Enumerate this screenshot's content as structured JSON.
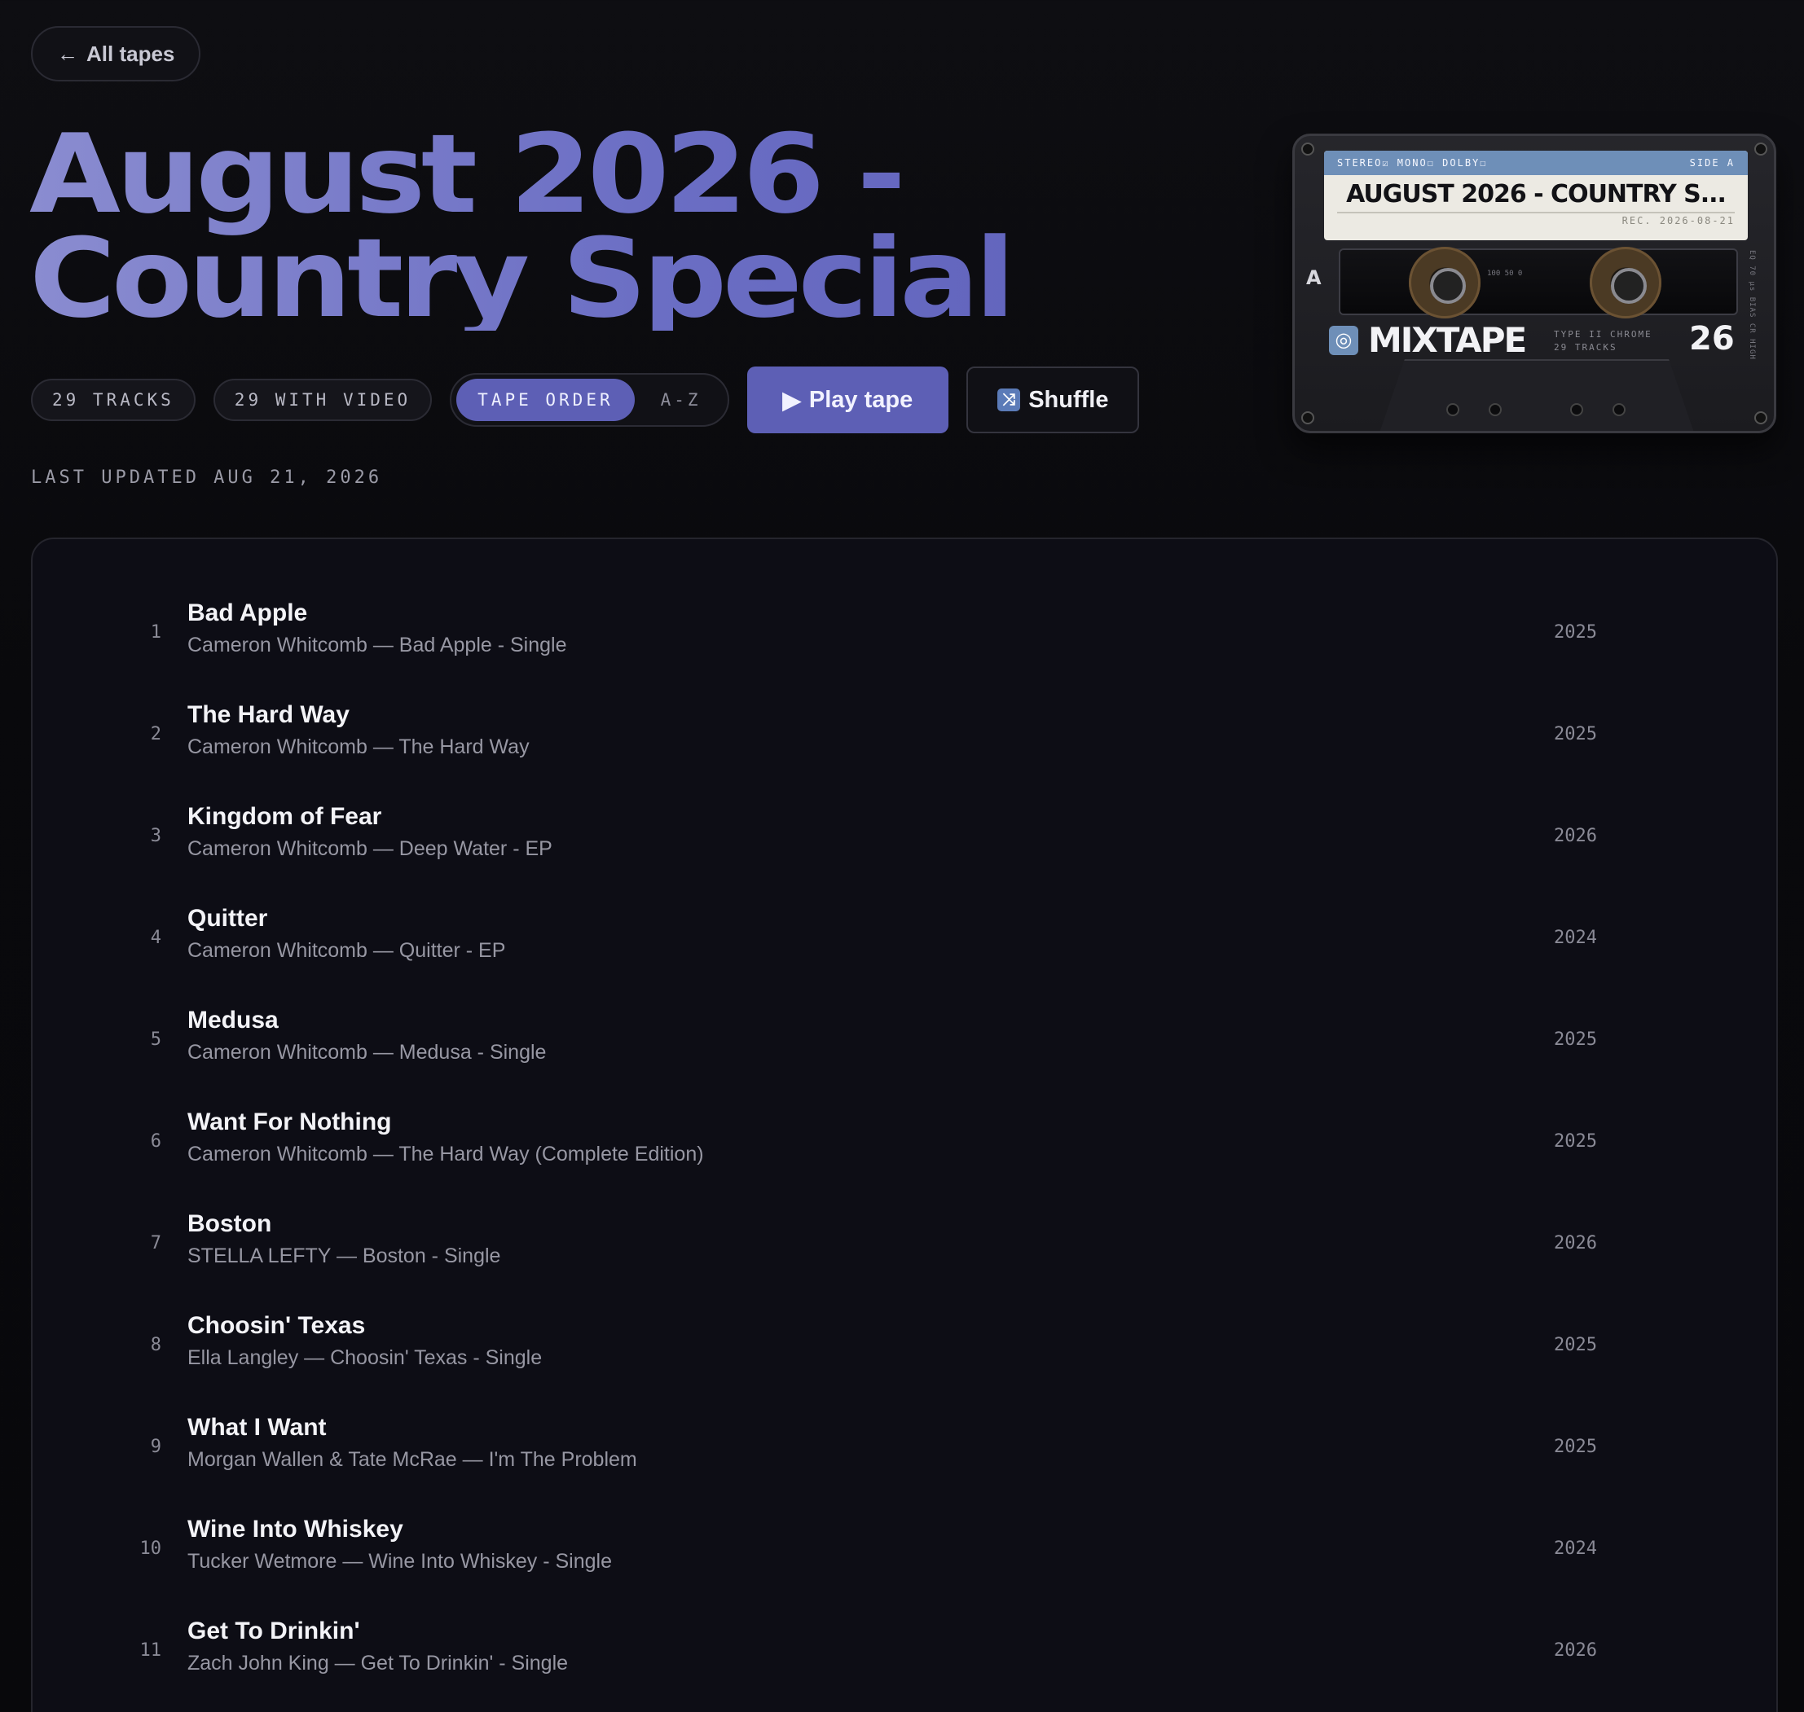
{
  "nav": {
    "back_label": "All tapes",
    "back_icon": "arrow-left-icon"
  },
  "header": {
    "title_line1": "August 2026 -",
    "title_line2": "Country Special",
    "tracks_badge": "29 TRACKS",
    "video_badge": "29 WITH VIDEO",
    "sort_options": [
      "TAPE ORDER",
      "A-Z"
    ],
    "sort_selected": "TAPE ORDER",
    "play_label": "Play tape",
    "play_icon": "play-icon",
    "shuffle_label": "Shuffle",
    "shuffle_icon": "shuffle-icon",
    "last_updated": "LAST UPDATED AUG 21, 2026"
  },
  "cassette": {
    "label_flags": "STEREO☑ MONO☐ DOLBY☐",
    "side_label": "SIDE A",
    "title": "AUGUST 2026 - COUNTRY S...",
    "rec_date": "REC. 2026-08-21",
    "side_letter": "A",
    "meter": "100   50   0",
    "vert_text": "EQ 70 μs BIAS CR HIGH",
    "brand": "MIXTAPE",
    "type_line1": "TYPE II CHROME",
    "type_line2": "29 TRACKS",
    "number": "26"
  },
  "tracks": [
    {
      "num": "1",
      "title": "Bad Apple",
      "sub": "Cameron Whitcomb — Bad Apple - Single",
      "year": "2025"
    },
    {
      "num": "2",
      "title": "The Hard Way",
      "sub": "Cameron Whitcomb — The Hard Way",
      "year": "2025"
    },
    {
      "num": "3",
      "title": "Kingdom of Fear",
      "sub": "Cameron Whitcomb — Deep Water - EP",
      "year": "2026"
    },
    {
      "num": "4",
      "title": "Quitter",
      "sub": "Cameron Whitcomb — Quitter - EP",
      "year": "2024"
    },
    {
      "num": "5",
      "title": "Medusa",
      "sub": "Cameron Whitcomb — Medusa - Single",
      "year": "2025"
    },
    {
      "num": "6",
      "title": "Want For Nothing",
      "sub": "Cameron Whitcomb — The Hard Way (Complete Edition)",
      "year": "2025"
    },
    {
      "num": "7",
      "title": "Boston",
      "sub": "STELLA LEFTY — Boston - Single",
      "year": "2026"
    },
    {
      "num": "8",
      "title": "Choosin' Texas",
      "sub": "Ella Langley — Choosin' Texas - Single",
      "year": "2025"
    },
    {
      "num": "9",
      "title": "What I Want",
      "sub": "Morgan Wallen & Tate McRae — I'm The Problem",
      "year": "2025"
    },
    {
      "num": "10",
      "title": "Wine Into Whiskey",
      "sub": "Tucker Wetmore — Wine Into Whiskey - Single",
      "year": "2024"
    },
    {
      "num": "11",
      "title": "Get To Drinkin'",
      "sub": "Zach John King — Get To Drinkin' - Single",
      "year": "2026"
    }
  ]
}
